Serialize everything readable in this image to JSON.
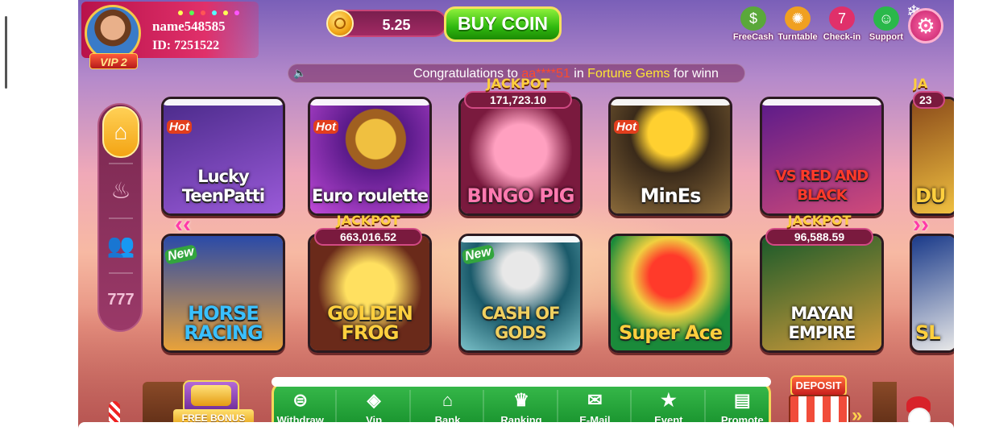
{
  "profile": {
    "name": "name548585",
    "id": "ID: 7251522",
    "vip": "VIP 2"
  },
  "balance": {
    "value": "5.25",
    "buy_label": "BUY COIN"
  },
  "top_icons": [
    {
      "label": "FreeCash",
      "icon": "cash-bag-icon",
      "color": "#5aa83a"
    },
    {
      "label": "Turntable",
      "icon": "wheel-icon",
      "color": "#f0a020"
    },
    {
      "label": "Check-in",
      "icon": "calendar-icon",
      "color": "#e0306a"
    },
    {
      "label": "Support",
      "icon": "headset-icon",
      "color": "#2ab84a"
    }
  ],
  "marquee": {
    "prefix": "Congratulations to",
    "user": "aa****51",
    "mid": "in",
    "game": "Fortune Gems",
    "suffix": "for winn"
  },
  "sidenav": [
    {
      "icon": "home-icon",
      "active": true
    },
    {
      "icon": "fire-icon",
      "active": false
    },
    {
      "icon": "people-icon",
      "active": false
    },
    {
      "icon": "slot-777-icon",
      "active": false
    }
  ],
  "games_row1": [
    {
      "title": "Lucky TeenPatti",
      "badge": "Hot",
      "jackpot": null,
      "color1": "#4a2a8a",
      "color2": "#9a5ad8"
    },
    {
      "title": "Euro roulette",
      "badge": "Hot",
      "jackpot": null,
      "color1": "#5a1a8a",
      "color2": "#c04ad8"
    },
    {
      "title": "BINGO PIG",
      "badge": null,
      "jackpot": "171,723.10",
      "color1": "#7a1a3e",
      "color2": "#f0609a"
    },
    {
      "title": "MinEs",
      "badge": "Hot",
      "jackpot": null,
      "color1": "#3a2a1a",
      "color2": "#8a6a3a"
    },
    {
      "title": "VS RED AND BLACK",
      "badge": null,
      "jackpot": null,
      "color1": "#5a1a8a",
      "color2": "#d04a7a"
    }
  ],
  "games_row2": [
    {
      "title": "HORSE RACING",
      "badge": "New",
      "jackpot": null,
      "color1": "#2a4aa8",
      "color2": "#e8a23a"
    },
    {
      "title": "GOLDEN FROG",
      "badge": null,
      "jackpot": "663,016.52",
      "color1": "#6a2a1a",
      "color2": "#f0c040"
    },
    {
      "title": "CASH OF GODS",
      "badge": "New",
      "jackpot": null,
      "color1": "#1a5a6a",
      "color2": "#7ac0c8"
    },
    {
      "title": "Super Ace",
      "badge": null,
      "jackpot": null,
      "color1": "#1a8a3a",
      "color2": "#f0d040"
    },
    {
      "title": "MAYAN EMPIRE",
      "badge": null,
      "jackpot": "96,588.59",
      "color1": "#1a5a2a",
      "color2": "#d09a3a"
    }
  ],
  "jackpot_label": "JACKPOT",
  "partial_right": {
    "jackpot_fragment": "23",
    "title_row1": "DU",
    "title_row2": "SL"
  },
  "bottom": {
    "free_bonus": "FREE BONUS",
    "deposit": "DEPOSIT",
    "items": [
      {
        "label": "Withdraw",
        "icon": "withdraw-icon"
      },
      {
        "label": "Vip",
        "icon": "diamond-icon"
      },
      {
        "label": "Bank",
        "icon": "bank-icon"
      },
      {
        "label": "Ranking",
        "icon": "trophy-icon"
      },
      {
        "label": "E-Mail",
        "icon": "mail-icon"
      },
      {
        "label": "Event",
        "icon": "gift-icon"
      },
      {
        "label": "Promote",
        "icon": "promote-icon"
      }
    ]
  }
}
